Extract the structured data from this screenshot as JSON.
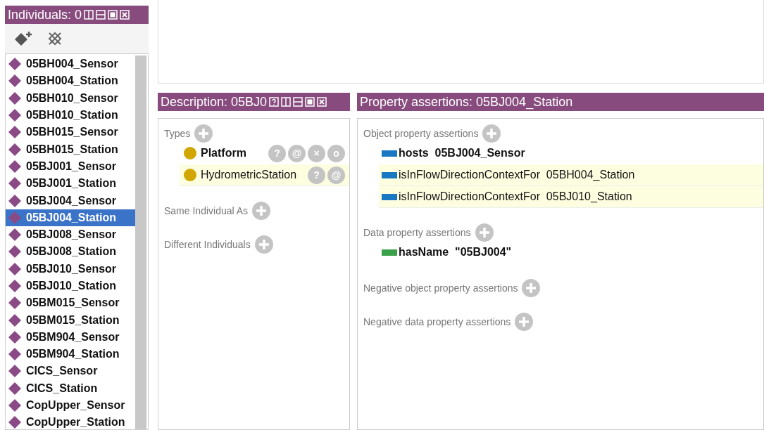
{
  "individuals_panel": {
    "title": "Individuals: 0",
    "items": [
      {
        "label": "05BH004_Sensor",
        "selected": false
      },
      {
        "label": "05BH004_Station",
        "selected": false
      },
      {
        "label": "05BH010_Sensor",
        "selected": false
      },
      {
        "label": "05BH010_Station",
        "selected": false
      },
      {
        "label": "05BH015_Sensor",
        "selected": false
      },
      {
        "label": "05BH015_Station",
        "selected": false
      },
      {
        "label": "05BJ001_Sensor",
        "selected": false
      },
      {
        "label": "05BJ001_Station",
        "selected": false
      },
      {
        "label": "05BJ004_Sensor",
        "selected": false
      },
      {
        "label": "05BJ004_Station",
        "selected": true
      },
      {
        "label": "05BJ008_Sensor",
        "selected": false
      },
      {
        "label": "05BJ008_Station",
        "selected": false
      },
      {
        "label": "05BJ010_Sensor",
        "selected": false
      },
      {
        "label": "05BJ010_Station",
        "selected": false
      },
      {
        "label": "05BM015_Sensor",
        "selected": false
      },
      {
        "label": "05BM015_Station",
        "selected": false
      },
      {
        "label": "05BM904_Sensor",
        "selected": false
      },
      {
        "label": "05BM904_Station",
        "selected": false
      },
      {
        "label": "CICS_Sensor",
        "selected": false
      },
      {
        "label": "CICS_Station",
        "selected": false
      },
      {
        "label": "CopUpper_Sensor",
        "selected": false
      },
      {
        "label": "CopUpper_Station",
        "selected": false
      }
    ]
  },
  "description_panel": {
    "title": "Description: 05BJ0",
    "sections": [
      {
        "label": "Types",
        "items": [
          {
            "label": "Platform",
            "inferred": false,
            "actions": [
              "?",
              "@",
              "×",
              "o"
            ]
          },
          {
            "label": "HydrometricStation",
            "inferred": true,
            "actions": [
              "?",
              "@"
            ]
          }
        ]
      },
      {
        "label": "Same Individual As"
      },
      {
        "label": "Different Individuals"
      }
    ]
  },
  "property_panel": {
    "title": "Property assertions: 05BJ004_Station",
    "sections": [
      {
        "label": "Object property assertions",
        "items": [
          {
            "kind": "object",
            "property": "hosts",
            "value": "05BJ004_Sensor",
            "inferred": false
          },
          {
            "kind": "object",
            "property": "isInFlowDirectionContextFor",
            "value": "05BH004_Station",
            "inferred": true
          },
          {
            "kind": "object",
            "property": "isInFlowDirectionContextFor",
            "value": "05BJ010_Station",
            "inferred": true
          }
        ]
      },
      {
        "label": "Data property assertions",
        "items": [
          {
            "kind": "data",
            "property": "hasName",
            "value": "\"05BJ004\"",
            "inferred": false
          }
        ]
      },
      {
        "label": "Negative object property assertions"
      },
      {
        "label": "Negative data property assertions"
      }
    ]
  }
}
